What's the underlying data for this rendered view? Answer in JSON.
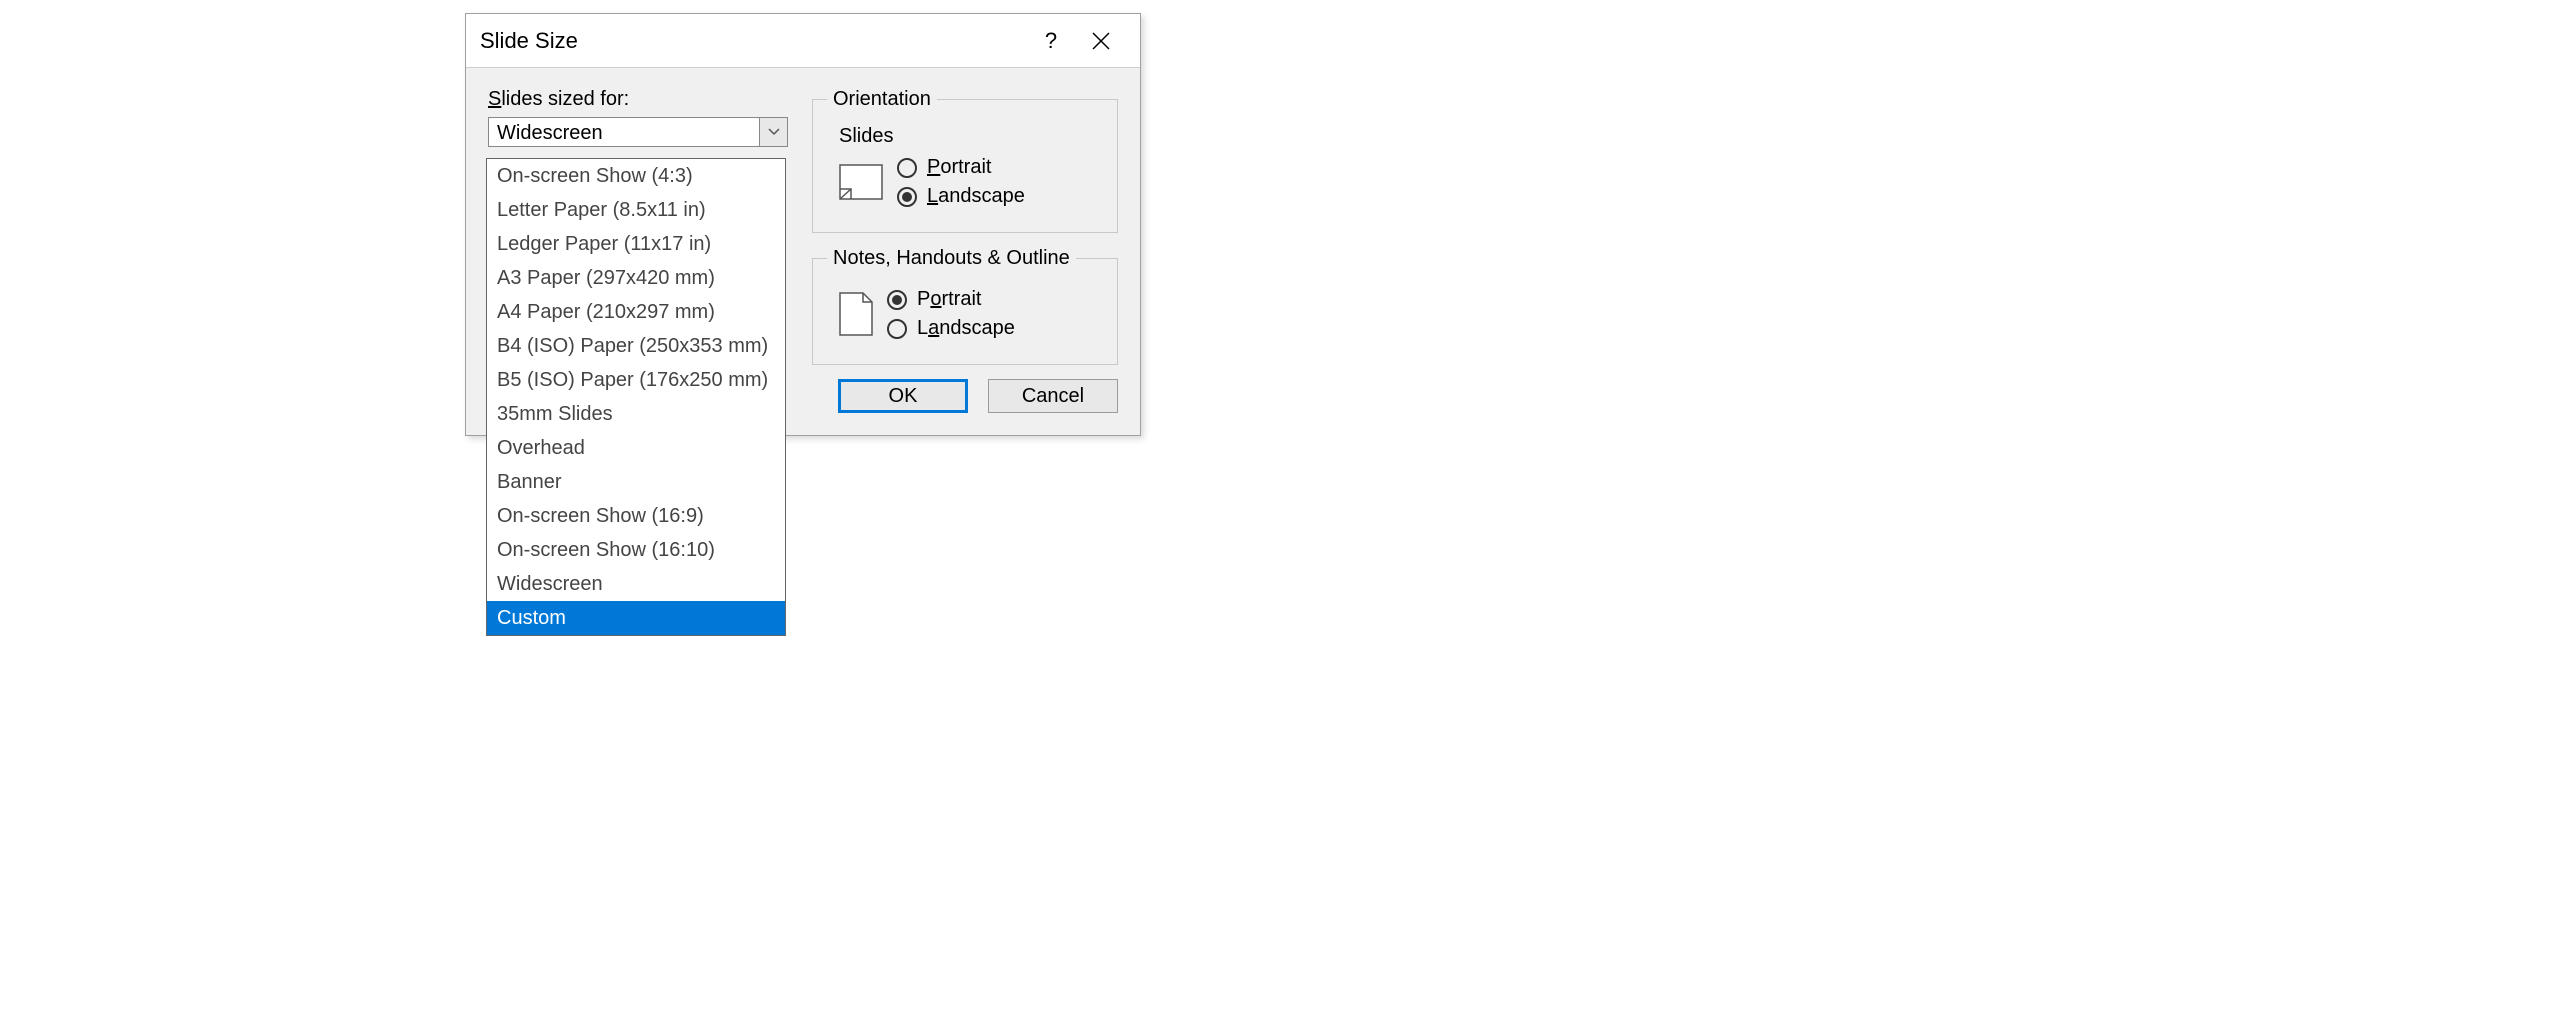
{
  "dialog": {
    "title": "Slide Size",
    "help": "?",
    "slides_sized_label": "Slides sized for:",
    "combobox_value": "Widescreen",
    "options": [
      "On-screen Show (4:3)",
      "Letter Paper (8.5x11 in)",
      "Ledger Paper (11x17 in)",
      "A3 Paper (297x420 mm)",
      "A4 Paper (210x297 mm)",
      "B4 (ISO) Paper (250x353 mm)",
      "B5 (ISO) Paper (176x250 mm)",
      "35mm Slides",
      "Overhead",
      "Banner",
      "On-screen Show (16:9)",
      "On-screen Show (16:10)",
      "Widescreen",
      "Custom"
    ],
    "selected_option_index": 13,
    "orientation_label": "Orientation",
    "slides_group_label": "Slides",
    "notes_group_label": "Notes, Handouts & Outline",
    "portrait_label": "Portrait",
    "landscape_label": "Landscape",
    "slides_selected": "Landscape",
    "notes_selected": "Portrait",
    "ok_label": "OK",
    "cancel_label": "Cancel"
  }
}
